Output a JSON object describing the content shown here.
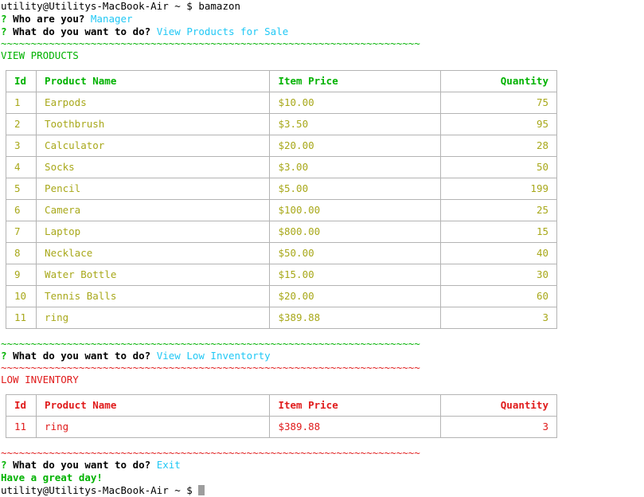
{
  "terminal": {
    "prompt_prefix": "utility@Utilitys-MacBook-Air ~ $",
    "command": "bamazon",
    "prompt_line_1": "utility@Utilitys-MacBook-Air ~ $ bamazon",
    "final_prompt": "utility@Utilitys-MacBook-Air ~ $",
    "cursor": "block-cursor"
  },
  "prompts": {
    "q_marker": "?",
    "who_are_you_label": "Who are you?",
    "who_are_you_answer": "Manager",
    "what_do_label": "What do you want to do?",
    "answer_view_products": "View Products for Sale",
    "answer_view_low": "View Low Inventorty",
    "answer_exit": "Exit"
  },
  "separators": {
    "squiggle_green": "~~~~~~~~~~~~~~~~~~~~~~~~~~~~~~~~~~~~~~~~~~~~~~~~~~~~~~~~~~~~~~~~~~~~~~",
    "squiggle_red": "~~~~~~~~~~~~~~~~~~~~~~~~~~~~~~~~~~~~~~~~~~~~~~~~~~~~~~~~~~~~~~~~~~~~~~"
  },
  "sections": {
    "view_products_heading": "VIEW PRODUCTS",
    "low_inventory_heading": "LOW INVENTORY",
    "goodbye": "Have a great day!"
  },
  "products_table": {
    "headers": [
      "Id",
      "Product Name",
      "Item Price",
      "Quantity"
    ],
    "rows": [
      [
        "1",
        "Earpods",
        "$10.00",
        "75"
      ],
      [
        "2",
        "Toothbrush",
        "$3.50",
        "95"
      ],
      [
        "3",
        "Calculator",
        "$20.00",
        "28"
      ],
      [
        "4",
        "Socks",
        "$3.00",
        "50"
      ],
      [
        "5",
        "Pencil",
        "$5.00",
        "199"
      ],
      [
        "6",
        "Camera",
        "$100.00",
        "25"
      ],
      [
        "7",
        "Laptop",
        "$800.00",
        "15"
      ],
      [
        "8",
        "Necklace",
        "$50.00",
        "40"
      ],
      [
        "9",
        "Water Bottle",
        "$15.00",
        "30"
      ],
      [
        "10",
        "Tennis Balls",
        "$20.00",
        "60"
      ],
      [
        "11",
        "ring",
        "$389.88",
        "3"
      ]
    ]
  },
  "low_inventory_table": {
    "headers": [
      "Id",
      "Product Name",
      "Item Price",
      "Quantity"
    ],
    "rows": [
      [
        "11",
        "ring",
        "$389.88",
        "3"
      ]
    ]
  },
  "colors": {
    "green": "#00b200",
    "cyan": "#21c8f5",
    "red": "#e01b1b",
    "olive": "#a8a81a",
    "border": "#b4b4b4",
    "cursor": "#9d9d9d",
    "background": "#ffffff"
  }
}
